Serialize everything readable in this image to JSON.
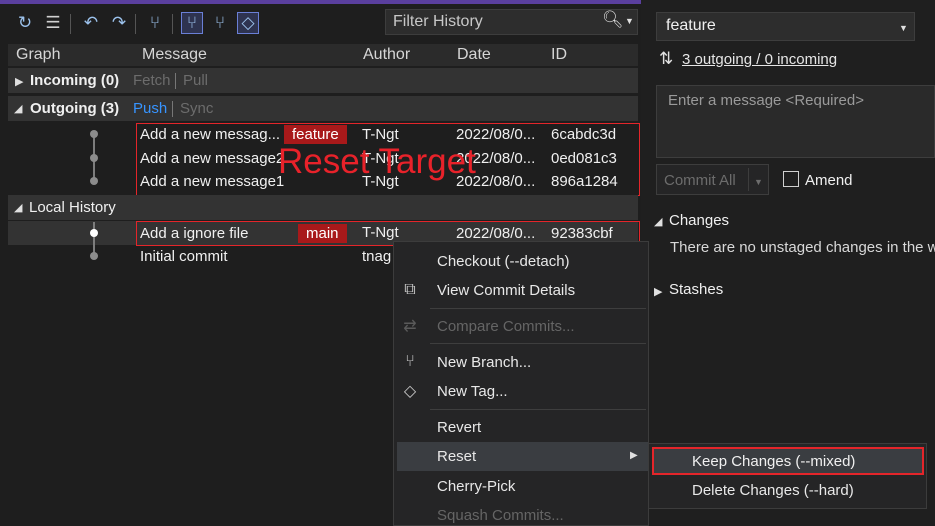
{
  "toolbar": {
    "filter_placeholder": "Filter History",
    "icons": [
      "refresh-icon",
      "list-icon",
      "fetch-icon",
      "pull-icon",
      "graph-icon",
      "local-branch-icon",
      "remote-branch-icon",
      "tag-icon"
    ]
  },
  "columns": {
    "graph": "Graph",
    "message": "Message",
    "author": "Author",
    "date": "Date",
    "id": "ID"
  },
  "sections": {
    "incoming": {
      "label": "Incoming (0)",
      "fetch": "Fetch",
      "pull": "Pull"
    },
    "outgoing": {
      "label": "Outgoing (3)",
      "push": "Push",
      "sync": "Sync"
    },
    "local": {
      "label": "Local History"
    }
  },
  "outgoing_commits": [
    {
      "message": "Add a new messag...",
      "tag": "feature",
      "author": "T-Ngt",
      "date": "2022/08/0...",
      "id": "6cabdc3d"
    },
    {
      "message": "Add a new message2",
      "tag": "",
      "author": "T-Ngt",
      "date": "2022/08/0...",
      "id": "0ed081c3"
    },
    {
      "message": "Add a new message1",
      "tag": "",
      "author": "T-Ngt",
      "date": "2022/08/0...",
      "id": "896a1284"
    }
  ],
  "local_commits": [
    {
      "message": "Add a ignore file",
      "tag": "main",
      "author": "T-Ngt",
      "date": "2022/08/0...",
      "id": "92383cbf"
    },
    {
      "message": "Initial commit",
      "tag": "",
      "author": "tnag",
      "date": "",
      "id": ""
    }
  ],
  "annotation": "Reset Target",
  "context_menu": {
    "checkout": "Checkout (--detach)",
    "view_details": "View Commit Details",
    "compare": "Compare Commits...",
    "new_branch": "New Branch...",
    "new_tag": "New Tag...",
    "revert": "Revert",
    "reset": "Reset",
    "cherry_pick": "Cherry-Pick",
    "squash": "Squash Commits..."
  },
  "reset_submenu": {
    "keep": "Keep Changes (--mixed)",
    "delete": "Delete Changes (--hard)"
  },
  "right_panel": {
    "branch": "feature",
    "outgoing_incoming": "3 outgoing / 0 incoming",
    "message_placeholder": "Enter a message <Required>",
    "commit_all": "Commit All",
    "amend": "Amend",
    "changes_header": "Changes",
    "changes_text": "There are no unstaged changes in the w",
    "stashes_header": "Stashes"
  },
  "colors": {
    "accent": "#5a3f9e",
    "tag_bg": "#a8191a",
    "highlight_red": "#e4252a",
    "link": "#3794ff"
  }
}
